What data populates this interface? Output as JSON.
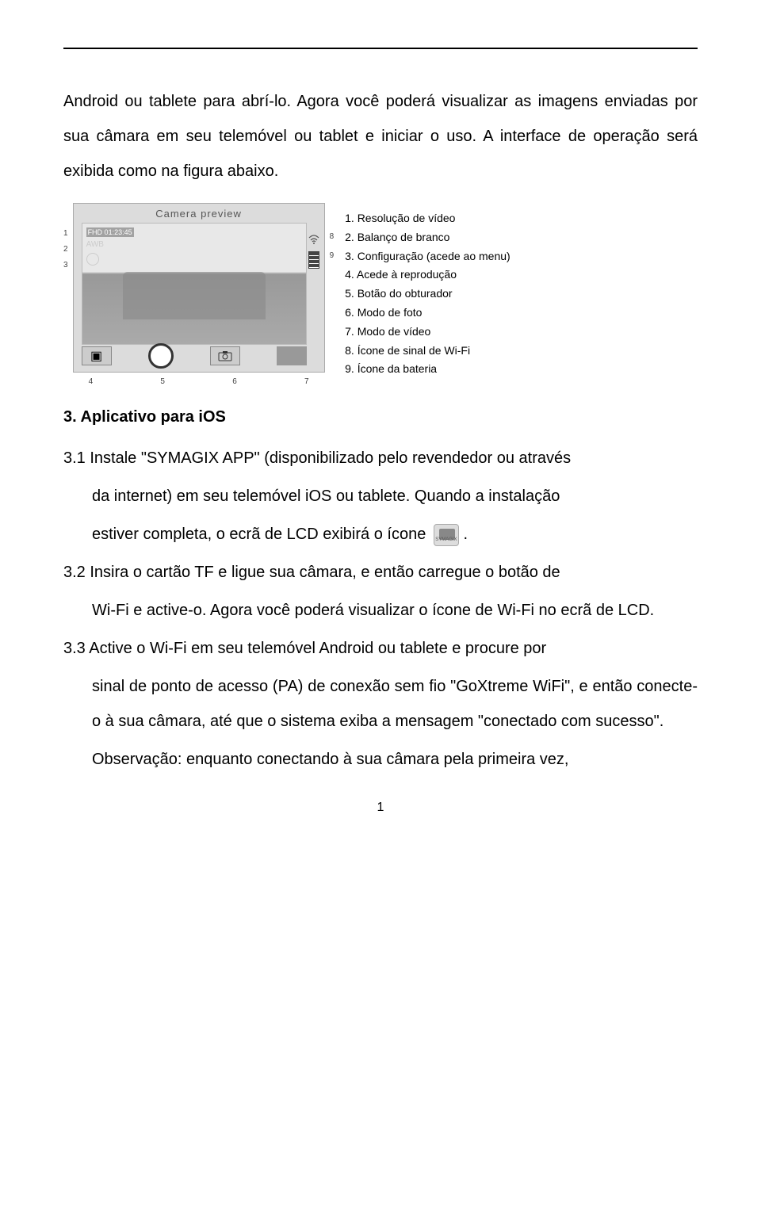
{
  "intro": "Android ou tablete para abrí-lo. Agora você poderá visualizar as imagens enviadas por sua câmara em seu telemóvel ou tablet e iniciar o uso. A interface de operação será exibida como na figura abaixo.",
  "preview_label": "Camera preview",
  "fhd_text": "FHD 01:23:45",
  "awb_text": "AWB",
  "left_markers": [
    "1",
    "2",
    "3"
  ],
  "right_markers": [
    "8",
    "9"
  ],
  "bottom_markers": [
    "4",
    "5",
    "6",
    "7"
  ],
  "legend": [
    "1. Resolução de vídeo",
    "2. Balanço de branco",
    "3. Configuração (acede ao menu)",
    "4. Acede à reprodução",
    "5. Botão do obturador",
    "6. Modo de foto",
    "7. Modo de vídeo",
    "8. Ícone de sinal de Wi-Fi",
    "9. Ícone da bateria"
  ],
  "section_title": "3. Aplicativo para iOS",
  "step31a": "3.1 Instale \"SYMAGIX APP\" (disponibilizado pelo revendedor ou através",
  "step31b": "da internet) em seu telemóvel iOS ou tablete. Quando a instalação",
  "step31c_pre": "estiver completa, o ecrã de LCD exibirá o ícone ",
  "step31c_post": ".",
  "app_icon_label": "SYMAGIX",
  "step32a": "3.2 Insira o cartão TF e ligue sua câmara, e então carregue o botão de",
  "step32b": "Wi-Fi e active-o. Agora você poderá visualizar o ícone de Wi-Fi no ecrã de LCD.",
  "step33a": "3.3 Active o Wi-Fi em seu telemóvel Android ou tablete e procure por",
  "step33b": "sinal de ponto de acesso (PA) de conexão sem fio \"GoXtreme WiFi\", e então conecte-o à sua câmara, até que o sistema exiba a mensagem \"conectado com sucesso\".",
  "obs": "Observação: enquanto conectando à sua câmara pela primeira vez,",
  "page_number": "1"
}
